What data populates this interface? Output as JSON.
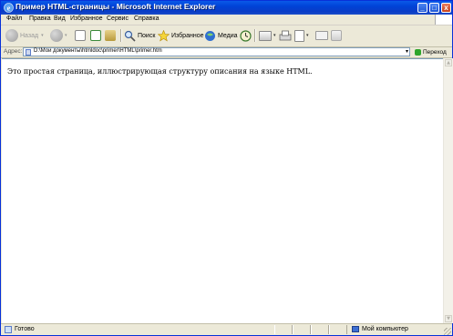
{
  "window": {
    "title": "Пример HTML-страницы - Microsoft Internet Explorer",
    "buttons": {
      "minimize": "_",
      "maximize": "□",
      "close": "x"
    }
  },
  "menubar": {
    "items": [
      "Файл",
      "Правка",
      "Вид",
      "Избранное",
      "Сервис",
      "Справка"
    ]
  },
  "toolbar": {
    "back_label": "Назад",
    "search_label": "Поиск",
    "favorites_label": "Избранное",
    "media_label": "Медиа",
    "icons": [
      "back-icon",
      "forward-icon",
      "stop-icon",
      "refresh-icon",
      "home-icon",
      "search-icon",
      "favorites-icon",
      "media-icon",
      "history-icon",
      "mail-icon",
      "print-icon",
      "edit-icon",
      "discuss-icon"
    ]
  },
  "addressbar": {
    "label": "Адрес:",
    "url": "D:\\Мои документы\\htmldoc\\primer\\HTML\\primer.htm",
    "go_label": "Переход",
    "links_label": "»"
  },
  "page": {
    "body_text": "Это простая страница, иллюстрирующая структуру описания на языке HTML."
  },
  "statusbar": {
    "status_text": "Готово",
    "zone_text": "Мой компьютер"
  },
  "colors": {
    "titlebar": "#0a5ae8",
    "chrome": "#ece9d8",
    "content_bg": "#ffffff"
  }
}
